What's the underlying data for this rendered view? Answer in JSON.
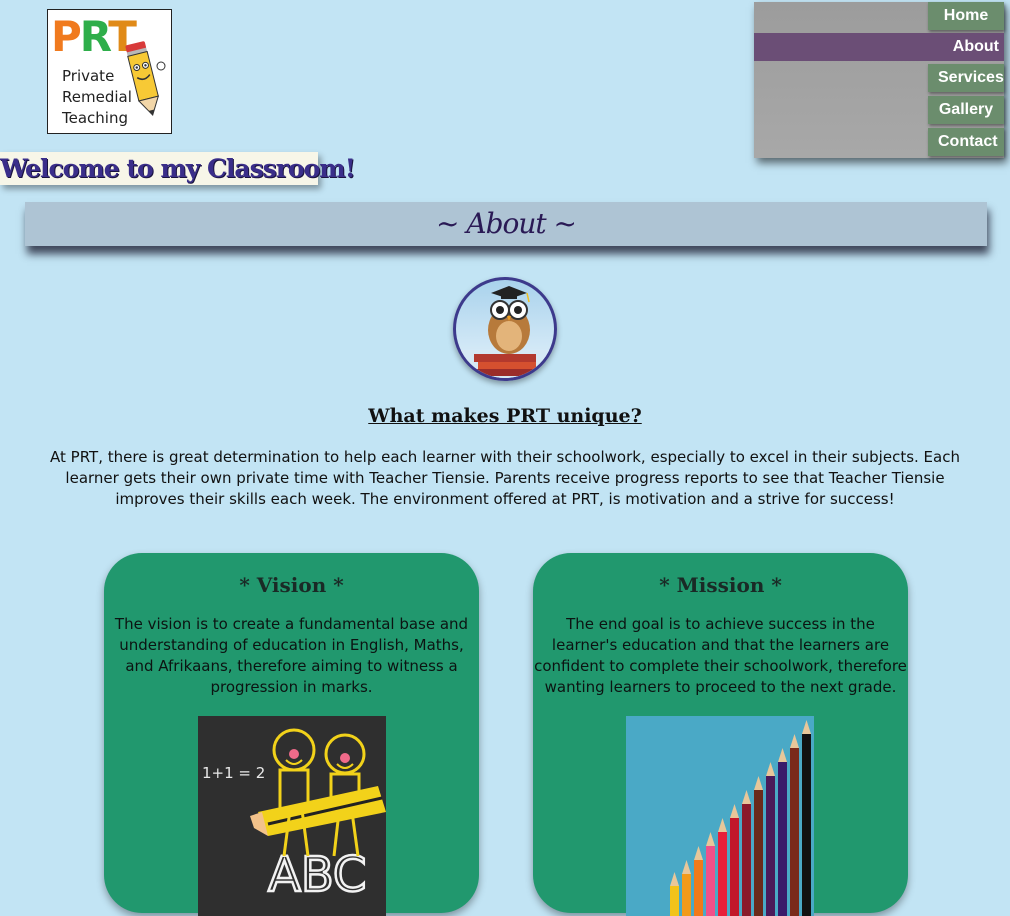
{
  "logo": {
    "letters": [
      "P",
      "R",
      "T"
    ],
    "lines": [
      "Private",
      "Remedial",
      "Teaching"
    ]
  },
  "welcome": "Welcome to my Classroom!",
  "nav": {
    "items": [
      {
        "label": "Home",
        "active": false
      },
      {
        "label": "About",
        "active": true
      },
      {
        "label": "Services",
        "active": false
      },
      {
        "label": "Gallery",
        "active": false
      },
      {
        "label": "Contact",
        "active": false
      }
    ]
  },
  "page_title": "~ About ~",
  "heading": "What makes PRT unique?",
  "intro": "At PRT, there is great determination to help each learner with their schoolwork, especially to excel in their subjects. Each learner gets their own private time with Teacher Tiensie. Parents receive progress reports to see that Teacher Tiensie improves their skills each week. The environment offered at PRT, is motivation and a strive for success!",
  "vision": {
    "title": "* Vision *",
    "text": "The vision is to create a fundamental base and understanding of education in English, Maths, and Afrikaans, therefore aiming to witness a progression in marks.",
    "chalk_equation": "1+1 = 2",
    "chalk_letters": "ABC"
  },
  "mission": {
    "title": "* Mission *",
    "text": "The end goal is to achieve success in the learner's education and that the learners are confident to complete their schoolwork, therefore wanting learners to proceed to the next grade."
  },
  "colors": {
    "background": "#c2e4f4",
    "nav_button": "#6b8d6d",
    "nav_active": "#6b4e76",
    "card": "#21986e"
  }
}
